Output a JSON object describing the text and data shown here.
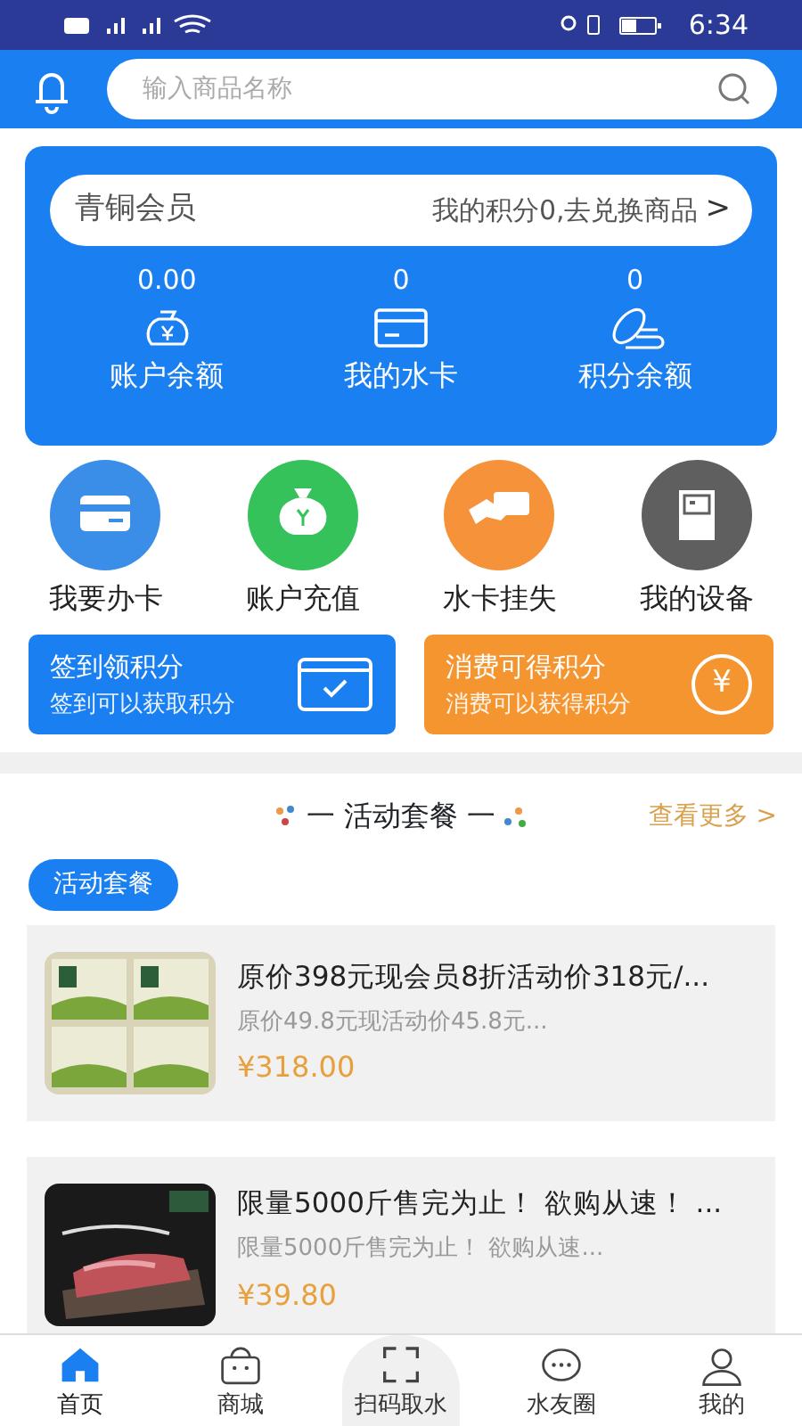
{
  "status_bar": {
    "time": "6:34"
  },
  "search": {
    "placeholder": "输入商品名称"
  },
  "member": {
    "level": "青铜会员",
    "points_link": "我的积分0,去兑换商品",
    "arrow": ">"
  },
  "stats": [
    {
      "kind": "money",
      "value": "0.00",
      "label": "账户余额"
    },
    {
      "kind": "card",
      "value": "0",
      "label": "我的水卡"
    },
    {
      "kind": "coins",
      "value": "0",
      "label": "积分余额"
    }
  ],
  "shortcuts": [
    {
      "kind": "card",
      "label": "我要办卡",
      "color": "#3a8ee8"
    },
    {
      "kind": "bag",
      "label": "账户充值",
      "color": "#36c25a"
    },
    {
      "kind": "hand",
      "label": "水卡挂失",
      "color": "#f5923a"
    },
    {
      "kind": "device",
      "label": "我的设备",
      "color": "#5f5f5f"
    }
  ],
  "banners": [
    {
      "kind": "checkin",
      "title": "签到领积分",
      "subtitle": "签到可以获取积分",
      "color": "#1a7ff0"
    },
    {
      "kind": "yuan",
      "title": "消费可得积分",
      "subtitle": "消费可以获得积分",
      "color": "#f5952f",
      "glyph": "¥"
    }
  ],
  "section": {
    "title": "一 活动套餐 一",
    "more": "查看更多",
    "more_arrow": ">"
  },
  "tag": "活动套餐",
  "products": [
    {
      "kind": "boxes",
      "title": "原价398元现会员8折活动价318元/...",
      "subtitle": "原价49.8元现活动价45.8元...",
      "price": "¥318.00"
    },
    {
      "kind": "meat",
      "title": "限量5000斤售完为止！ 欲购从速！ ...",
      "subtitle": "限量5000斤售完为止！ 欲购从速...",
      "price": "¥39.80"
    }
  ],
  "tabbar": [
    {
      "kind": "home",
      "label": "首页",
      "selected": true
    },
    {
      "kind": "shop",
      "label": "商城",
      "selected": false
    },
    {
      "kind": "scan",
      "label": "扫码取水",
      "selected": false
    },
    {
      "kind": "chat",
      "label": "水友圈",
      "selected": false
    },
    {
      "kind": "user",
      "label": "我的",
      "selected": false
    }
  ]
}
